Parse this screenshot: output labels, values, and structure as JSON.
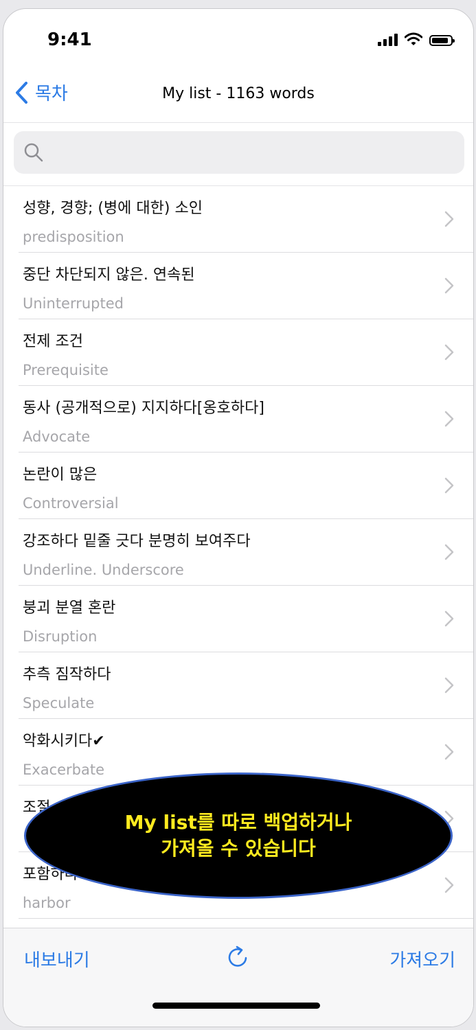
{
  "status_bar": {
    "time": "9:41",
    "battery_level": 0.9
  },
  "nav": {
    "back_label": "목차",
    "title": "My list - 1163 words"
  },
  "search": {
    "placeholder": "",
    "value": ""
  },
  "list": {
    "items": [
      {
        "primary": "성향, 경향; (병에 대한) 소인",
        "secondary": "predisposition"
      },
      {
        "primary": "중단 차단되지 않은. 연속된",
        "secondary": "Uninterrupted"
      },
      {
        "primary": "전제 조건",
        "secondary": "Prerequisite"
      },
      {
        "primary": "동사  (공개적으로) 지지하다[옹호하다]",
        "secondary": "Advocate"
      },
      {
        "primary": "논란이 많은",
        "secondary": "Controversial"
      },
      {
        "primary": "강조하다 밑줄 긋다 분명히 보여주다",
        "secondary": "Underline. Underscore"
      },
      {
        "primary": "붕괴 분열 혼란",
        "secondary": "Disruption"
      },
      {
        "primary": "추측 짐작하다",
        "secondary": "Speculate"
      },
      {
        "primary": "악화시키다✔",
        "secondary": "Exacerbate"
      },
      {
        "primary": "조절",
        "secondary": ""
      },
      {
        "primary": "포함하다",
        "secondary": "harbor"
      }
    ]
  },
  "toolbar": {
    "export_label": "내보내기",
    "import_label": "가져오기",
    "refresh_icon": "refresh-icon"
  },
  "callout": {
    "line1": "My list를 따로 백업하거나",
    "line2": "가져올 수 있습니다"
  },
  "colors": {
    "accent": "#2c7be5",
    "callout_text": "#ffeb1f",
    "callout_bg": "#000000",
    "callout_border": "#3b64c8"
  }
}
